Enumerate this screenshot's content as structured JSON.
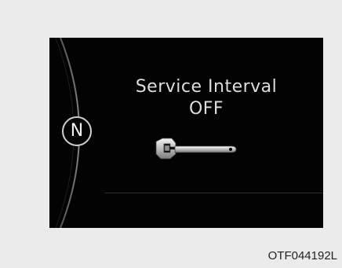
{
  "display": {
    "gear_indicator": "N",
    "message_title": "Service Interval",
    "message_status": "OFF",
    "icon": "wrench-icon"
  },
  "figure_code": "OTF044192L"
}
